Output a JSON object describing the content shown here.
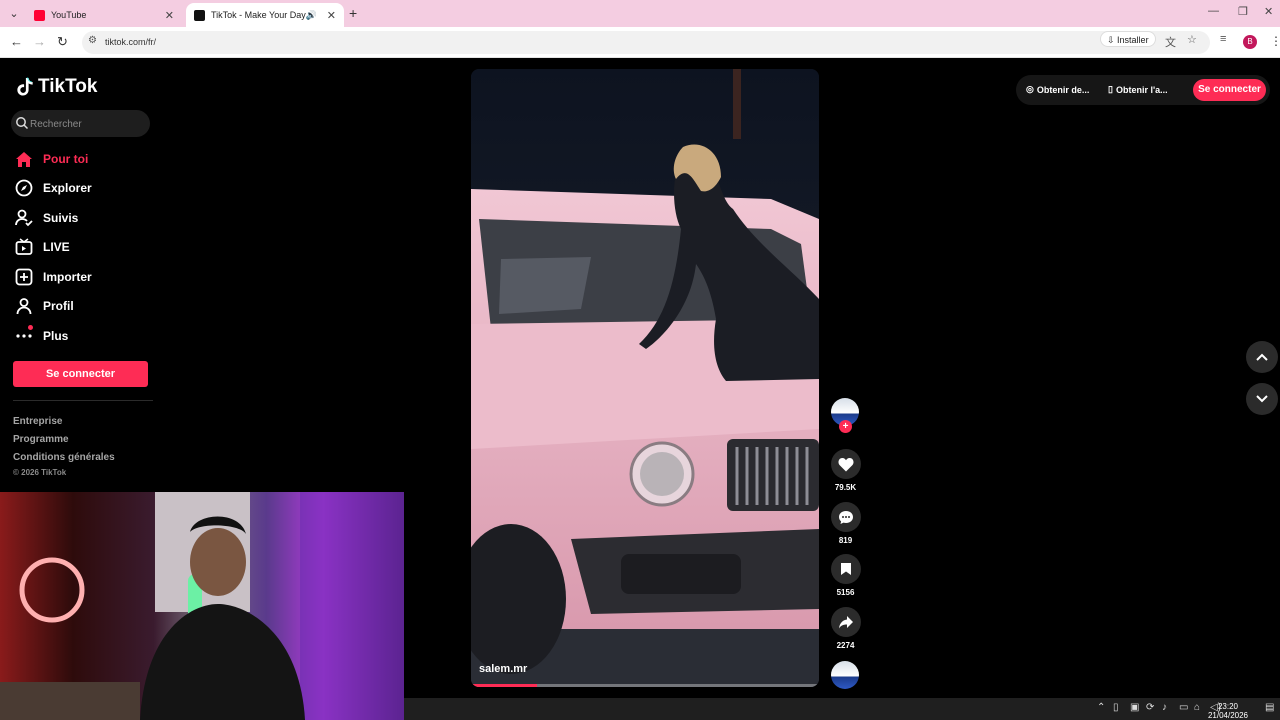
{
  "browser": {
    "tabs": [
      {
        "title": "YouTube",
        "favicon_color": "#ff0033"
      },
      {
        "title": "TikTok - Make Your Day",
        "favicon_color": "#111111"
      }
    ],
    "url": "tiktok.com/fr/",
    "install_label": "Installer",
    "profile_initial": "B"
  },
  "sidebar": {
    "logo_text": "TikTok",
    "search_placeholder": "Rechercher",
    "items": [
      {
        "label": "Pour toi",
        "icon": "home-icon",
        "active": true
      },
      {
        "label": "Explorer",
        "icon": "compass-icon"
      },
      {
        "label": "Suivis",
        "icon": "following-icon"
      },
      {
        "label": "LIVE",
        "icon": "live-icon"
      },
      {
        "label": "Importer",
        "icon": "upload-icon"
      },
      {
        "label": "Profil",
        "icon": "profile-icon"
      },
      {
        "label": "Plus",
        "icon": "more-icon"
      }
    ],
    "login_label": "Se connecter",
    "footer_links": [
      "Entreprise",
      "Programme",
      "Conditions générales"
    ],
    "copyright": "© 2026 TikTok"
  },
  "video": {
    "author": "salem.mr",
    "progress": 0.19,
    "likes": "79.5K",
    "comments": "819",
    "saves": "5156",
    "shares": "2274"
  },
  "topbar": {
    "link1": "Obtenir de...",
    "link2": "Obtenir l'a...",
    "login_label": "Se connecter"
  },
  "taskbar": {
    "time": "23:20",
    "date": "21/04/2026"
  },
  "colors": {
    "accent": "#fe2c55",
    "tab_strip": "#f4cde1"
  }
}
